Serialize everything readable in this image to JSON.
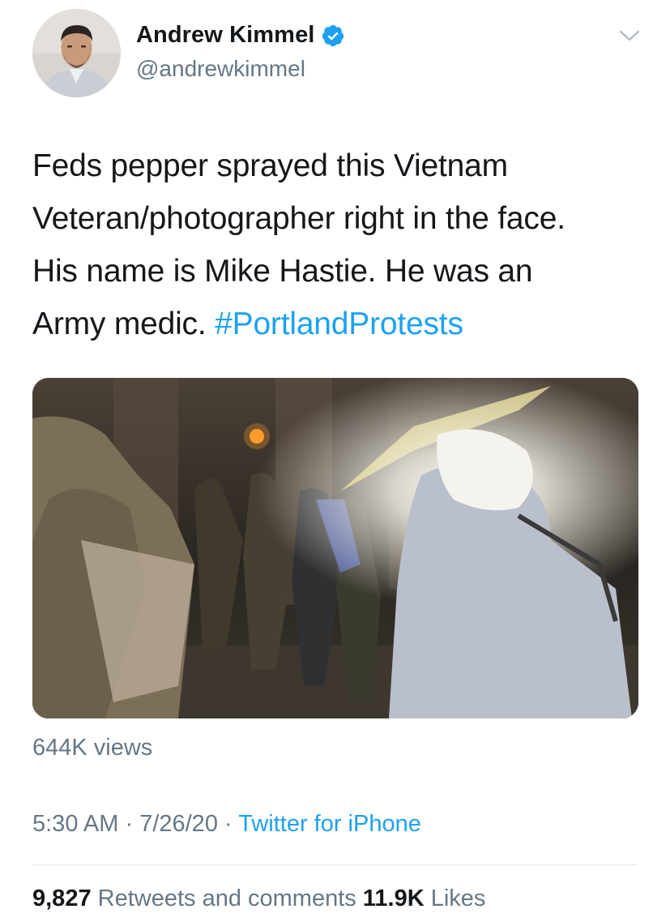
{
  "user": {
    "display_name": "Andrew Kimmel",
    "handle": "@andrewkimmel",
    "verified": true
  },
  "tweet": {
    "text_lines": [
      "Feds pepper sprayed this Vietnam",
      "Veteran/photographer right in the face.",
      "His name is Mike Hastie. He was an"
    ],
    "text_last_prefix": "Army medic. ",
    "hashtag": "#PortlandProtests"
  },
  "media": {
    "views": "644K views"
  },
  "meta": {
    "time": "5:30 AM",
    "separator": " · ",
    "date": "7/26/20",
    "source": "Twitter for iPhone"
  },
  "stats": {
    "retweets_count": "9,827",
    "retweets_label": "Retweets and comments",
    "likes_count": "11.9K",
    "likes_label": "Likes"
  },
  "colors": {
    "accent": "#1da1f2",
    "secondary_text": "#657786",
    "primary_text": "#14171a",
    "divider": "#e1e8ed"
  },
  "icons": {
    "verified": "verified-badge-icon",
    "more": "chevron-down-icon"
  }
}
